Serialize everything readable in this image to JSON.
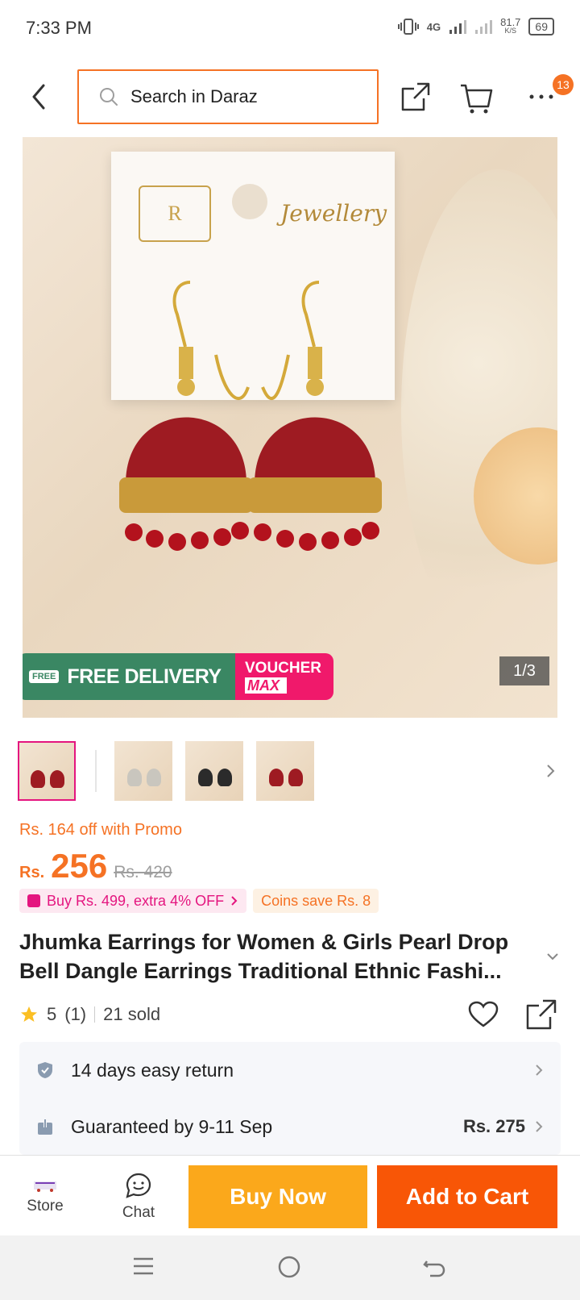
{
  "status_bar": {
    "time": "7:33 PM",
    "network": "4G",
    "speed": "81.7",
    "speed_unit": "K/S",
    "battery": "69"
  },
  "header": {
    "search_placeholder": "Search in Daraz",
    "cart_badge": "13",
    "back_icon": "chevron-left-icon",
    "share_icon": "share-icon",
    "cart_icon": "cart-icon",
    "more_icon": "more-icon"
  },
  "gallery": {
    "card_logo_letter": "R",
    "card_text": "Jewellery",
    "free_delivery_tag": "FREE",
    "free_delivery": "FREE DELIVERY",
    "voucher_line1": "VOUCHER",
    "voucher_line2": "MAX",
    "counter": "1/3",
    "thumbnails": [
      "red",
      "silver",
      "black",
      "red"
    ]
  },
  "pricing": {
    "promo": "Rs. 164 off with Promo",
    "currency": "Rs.",
    "price": "256",
    "original_price": "Rs. 420",
    "offer_chip": "Buy Rs. 499, extra 4% OFF",
    "coins_chip": "Coins save Rs. 8"
  },
  "product": {
    "title": "Jhumka Earrings for Women & Girls Pearl Drop Bell Dangle Earrings Traditional Ethnic Fashi...",
    "rating": "5",
    "rating_count": "(1)",
    "sold": "21 sold"
  },
  "services": [
    {
      "label": "14 days easy return",
      "value": ""
    },
    {
      "label": "Guaranteed by 9-11 Sep",
      "value": "Rs. 275"
    }
  ],
  "action_bar": {
    "store_label": "Store",
    "chat_label": "Chat",
    "buy_now": "Buy Now",
    "add_to_cart": "Add to Cart"
  },
  "colors": {
    "brand_orange": "#f57224",
    "buy_now": "#fba81b",
    "add_to_cart": "#f85606",
    "voucher_pink": "#f0196b",
    "delivery_green": "#3a8763"
  }
}
